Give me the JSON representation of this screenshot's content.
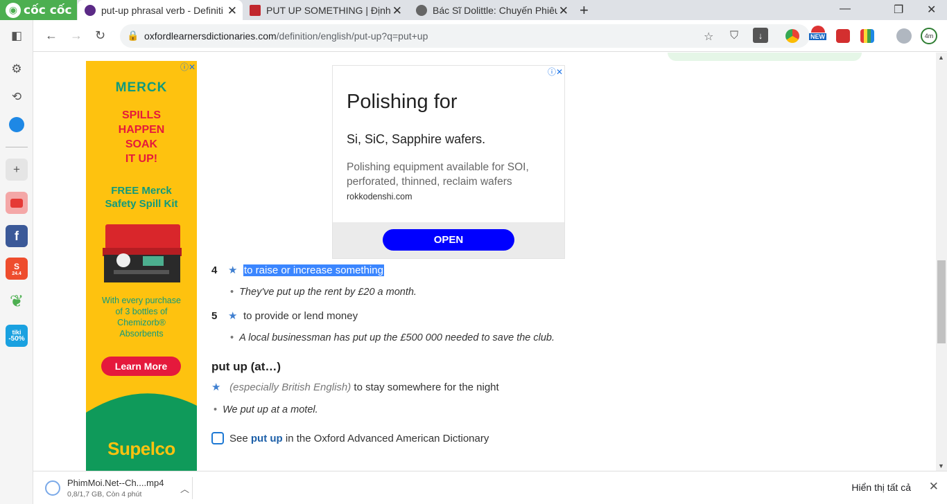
{
  "browser": {
    "brand": "cốc cốc",
    "tabs": [
      {
        "title": "put-up phrasal verb - Definiti"
      },
      {
        "title": "PUT UP SOMETHING | Định n"
      },
      {
        "title": "Bác Sĩ Dolittle: Chuyến Phiêu"
      }
    ],
    "url_host": "oxfordlearnersdictionaries.com",
    "url_path": "/definition/english/put-up?q=put+up",
    "badge_new": "NEW",
    "avatar_text": "4m"
  },
  "sidebar": {
    "shopee_badge": "24.4",
    "tiki_label": "tiki",
    "tiki_discount": "-50%"
  },
  "ad_left": {
    "brand": "MERCK",
    "headline_lines": [
      "SPILLS",
      "HAPPEN",
      "SOAK",
      "IT UP!"
    ],
    "offer_lines": [
      "FREE Merck",
      "Safety Spill Kit"
    ],
    "body_lines": [
      "With every purchase",
      "of 3 bottles of",
      "Chemizorb®",
      "Absorbents"
    ],
    "button": "Learn More",
    "footer_brand": "Supelco"
  },
  "ad_mid": {
    "title": "Polishing for",
    "subtitle": "Si, SiC, Sapphire wafers.",
    "body": "Polishing equipment available for SOI, perforated, thinned, reclaim wafers",
    "domain": "rokkodenshi.com",
    "button": "OPEN"
  },
  "entry": {
    "senses": [
      {
        "num": "4",
        "definition": "to raise or increase something",
        "example": "They've put up the rent by £20 a month."
      },
      {
        "num": "5",
        "definition": "to provide or lend money",
        "example": "A local businessman has put up the £500 000 needed to save the club."
      }
    ],
    "phrasal_heading": "put up (at…)",
    "phrasal_label": "(especially British English)",
    "phrasal_definition": "to stay somewhere for the night",
    "phrasal_example": "We put up at a motel.",
    "see_prefix": "See",
    "see_link": "put up",
    "see_suffix": "in the Oxford Advanced American Dictionary"
  },
  "downloads": {
    "file_name": "PhimMoi.Net--Ch....mp4",
    "file_status": "0,8/1,7 GB, Còn 4 phút",
    "show_all": "Hiển thị tất cả"
  },
  "colors": {
    "brand_green": "#4caf50",
    "selection": "#3b86ff",
    "ad_yellow": "#fec20f",
    "ad_button_blue": "#0000ff",
    "link_blue": "#1c5fa8"
  }
}
